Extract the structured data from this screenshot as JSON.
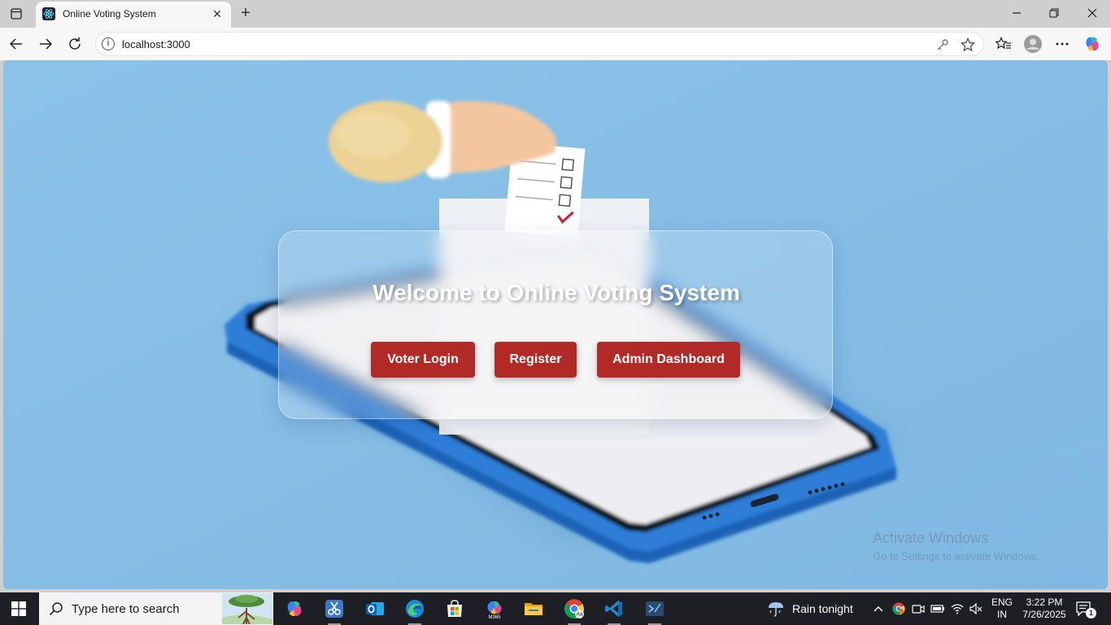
{
  "browser": {
    "tab_title": "Online Voting System",
    "tab_close": "✕",
    "new_tab": "+",
    "url": "localhost:3000"
  },
  "page": {
    "title": "Welcome to Online Voting System",
    "buttons": {
      "voter_login": "Voter Login",
      "register": "Register",
      "admin_dashboard": "Admin Dashboard"
    },
    "button_color": "#b22a27",
    "background_color": "#85bde4"
  },
  "watermark": {
    "line1": "Activate Windows",
    "line2": "Go to Settings to activate Windows."
  },
  "taskbar": {
    "search_placeholder": "Type here to search",
    "weather": "Rain tonight",
    "lang_line1": "ENG",
    "lang_line2": "IN",
    "time": "3:22 PM",
    "date": "7/26/2025",
    "notification_count": "1",
    "apps": [
      "copilot-app",
      "snipping-tool",
      "outlook",
      "edge",
      "microsoft-store",
      "m365",
      "file-explorer",
      "chrome",
      "vscode",
      "terminal"
    ]
  }
}
